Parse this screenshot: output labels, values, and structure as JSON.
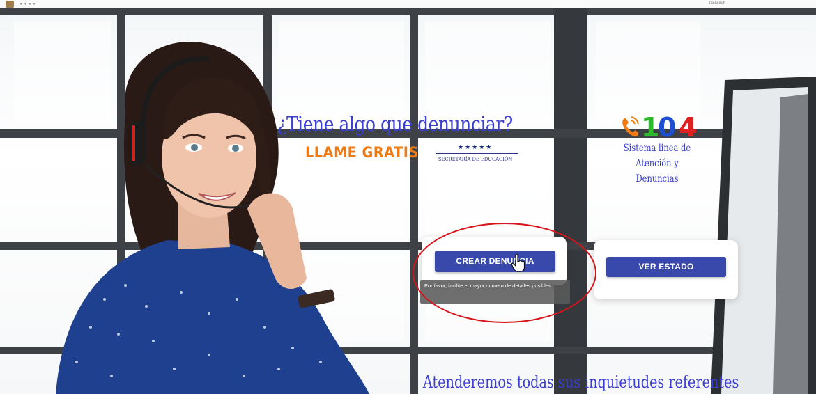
{
  "browser": {
    "url_text": "• • • •",
    "right_text": "Tasksiluff"
  },
  "hero": {
    "headline": "¿Tiene algo que denunciar?",
    "call_free": "LLAME GRATIS",
    "stars": "★★★★★",
    "secretaria": "SECRETARÍA DE EDUCACIÓN"
  },
  "hotline": {
    "digits": [
      "1",
      "0",
      "4"
    ],
    "digit_colors": [
      "#2eb82e",
      "#1f4fd1",
      "#e02020"
    ],
    "phone_color": "#f07a14",
    "system_line1": "Sistema linea de",
    "system_line2": "Atención y Denuncias"
  },
  "actions": {
    "create_label": "CREAR DENUNCIA",
    "status_label": "VER ESTADO",
    "tooltip": "Por favor, facilite el mayor numero de detalles posibles"
  },
  "footer": {
    "message": "Atenderemos todas sus inquietudes referentes"
  },
  "colors": {
    "accent": "#3949ab",
    "headline": "#3a3fd0",
    "annotation": "#d8141b"
  }
}
